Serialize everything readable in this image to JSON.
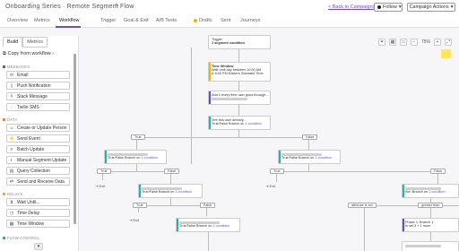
{
  "header": {
    "title": "Onboarding Series · Remote Segment Flow",
    "back_link": "< Back to Campaigns",
    "follow": "Follow",
    "actions": "Campaign Actions"
  },
  "tabs": {
    "overview": "Overview",
    "metrics": "Metrics",
    "workflow": "Workflow",
    "trigger": "Trigger",
    "goal": "Goal & Exit",
    "ab": "A/B Tests",
    "drafts": "Drafts",
    "sent": "Sent",
    "journeys": "Journeys"
  },
  "sidebar": {
    "build": "Build",
    "metrics": "Metrics",
    "copy": "Copy from workflow",
    "sections": {
      "messages": "MESSAGES",
      "data": "DATA",
      "delays": "DELAYS",
      "flow": "FLOW CONTROL"
    },
    "messages": [
      "Email",
      "Push Notification",
      "Slack Message",
      "Twilio SMS"
    ],
    "data": [
      "Create or Update Person",
      "Send Event",
      "Batch Update",
      "Manual Segment Update",
      "Query Collection",
      "Send and Receive Data"
    ],
    "delays": [
      "Wait Until...",
      "Time Delay",
      "Time Window"
    ]
  },
  "canvas": {
    "zoom": "75%",
    "trigger_label": "Trigger",
    "trigger_sub": "1 segment condition",
    "time_window_title": "Time Window",
    "time_window_l1": "Wait until day between 10:00 AM",
    "time_window_l2": "& 6:00 PM Eastern Standard Time",
    "add_every": "Add 1 every time user goes through...",
    "see_already": "See this user already...",
    "true_false_branch": "True/False Branch on",
    "one_condition": "1 condition",
    "true": "True",
    "false": "False",
    "exit": "Exit",
    "exit2": "Exit",
    "exit3": "Exit",
    "attribute_is_set": "attribute is set",
    "greater_than": "greater than",
    "phase": "Phase 1: Branch 1",
    "phase_sub": "Is set 3 + 1 more",
    "attr_branch": "Attr. Branch on"
  },
  "colors": {
    "accent": "#6b4bd1",
    "draft": "#f0b400",
    "teal": "#22b5a5",
    "orange": "#e8892b",
    "yellow": "#ffe45c"
  }
}
